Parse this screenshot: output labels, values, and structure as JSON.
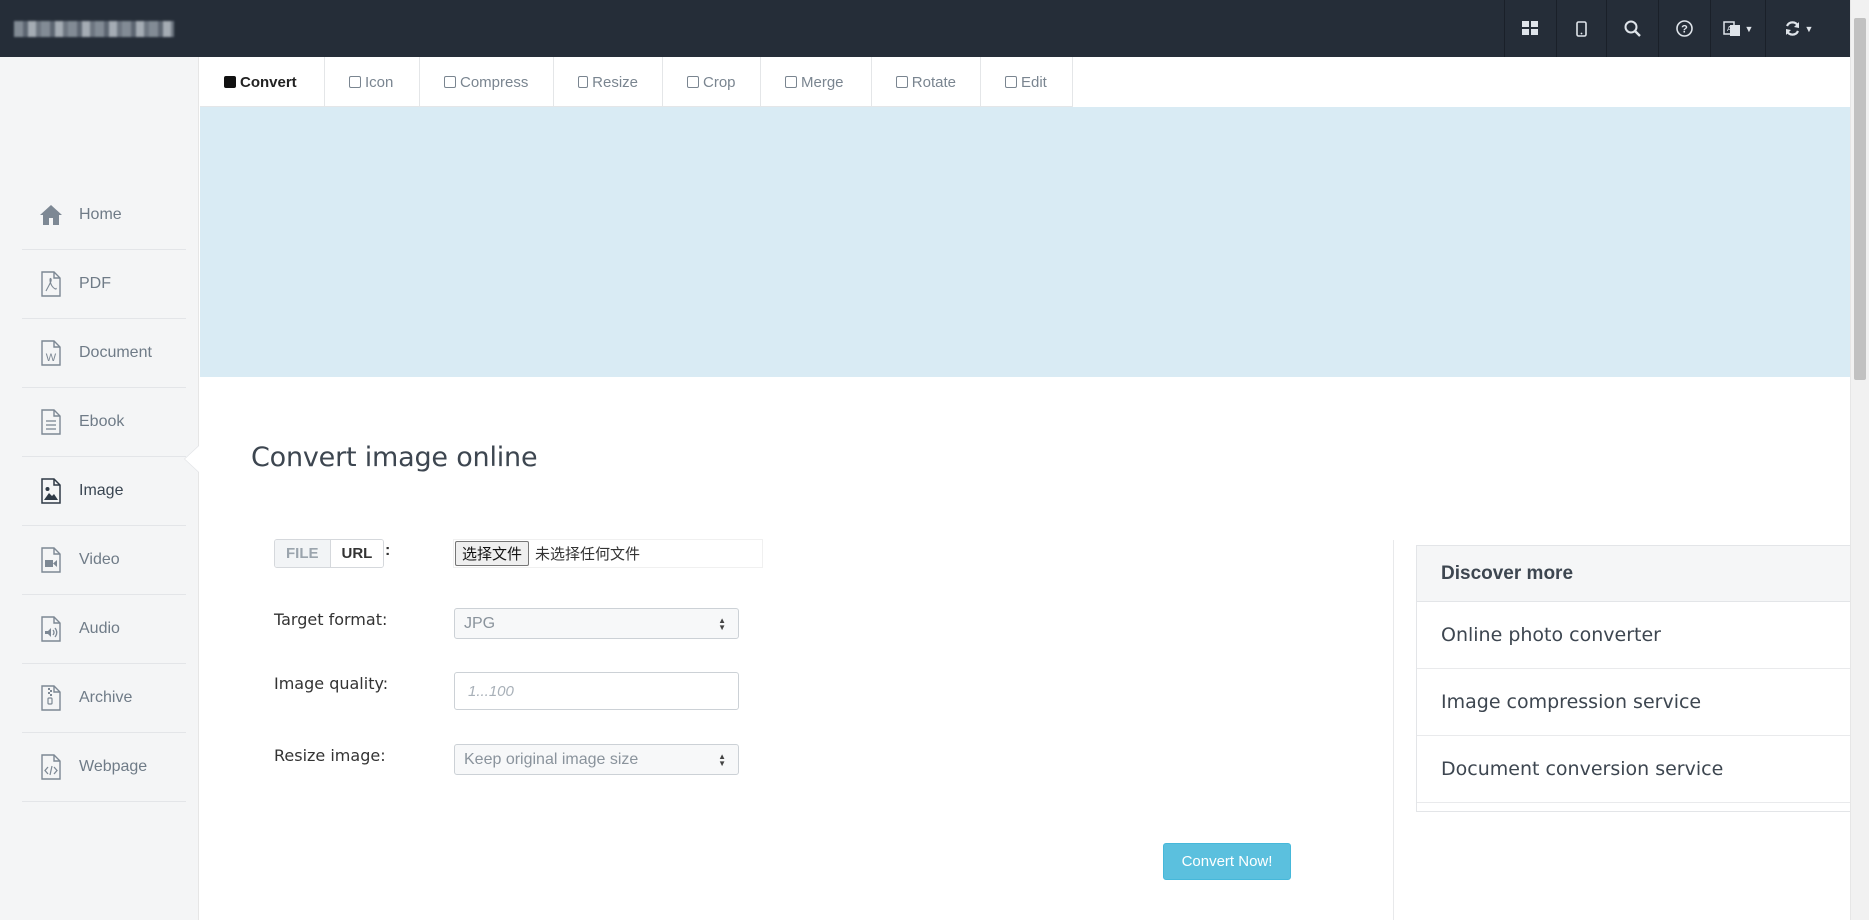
{
  "topbar": {
    "buttons": [
      {
        "icon": "grid-icon"
      },
      {
        "icon": "tablet-icon"
      },
      {
        "icon": "search-icon"
      },
      {
        "icon": "help-icon"
      },
      {
        "icon": "language-icon"
      },
      {
        "icon": "refresh-icon"
      }
    ]
  },
  "sidebar": {
    "items": [
      {
        "label": "Home",
        "icon": "home-icon"
      },
      {
        "label": "PDF",
        "icon": "pdf-file-icon"
      },
      {
        "label": "Document",
        "icon": "word-file-icon"
      },
      {
        "label": "Ebook",
        "icon": "ebook-file-icon"
      },
      {
        "label": "Image",
        "icon": "image-file-icon",
        "active": true
      },
      {
        "label": "Video",
        "icon": "video-file-icon"
      },
      {
        "label": "Audio",
        "icon": "audio-file-icon"
      },
      {
        "label": "Archive",
        "icon": "archive-file-icon"
      },
      {
        "label": "Webpage",
        "icon": "code-file-icon"
      }
    ]
  },
  "tabs": [
    {
      "label": "Convert",
      "active": true
    },
    {
      "label": "Icon"
    },
    {
      "label": "Compress"
    },
    {
      "label": "Resize"
    },
    {
      "label": "Crop"
    },
    {
      "label": "Merge"
    },
    {
      "label": "Rotate"
    },
    {
      "label": "Edit"
    }
  ],
  "main": {
    "title": "Convert image online",
    "source": {
      "file_label": "FILE",
      "url_label": "URL",
      "colon": ":"
    },
    "file_input": {
      "button": "选择文件",
      "status": "未选择任何文件"
    },
    "target_format": {
      "label": "Target format:",
      "value": "JPG"
    },
    "image_quality": {
      "label": "Image quality:",
      "placeholder": "1...100"
    },
    "resize_image": {
      "label": "Resize image:",
      "value": "Keep original image size"
    },
    "submit": "Convert Now!"
  },
  "discover": {
    "title": "Discover more",
    "items": [
      "Online photo converter",
      "Image compression service",
      "Document conversion service"
    ]
  },
  "colors": {
    "topbar": "#252d38",
    "banner": "#d9ebf4",
    "button": "#5bc0de",
    "sidebar": "#f4f5f6"
  }
}
